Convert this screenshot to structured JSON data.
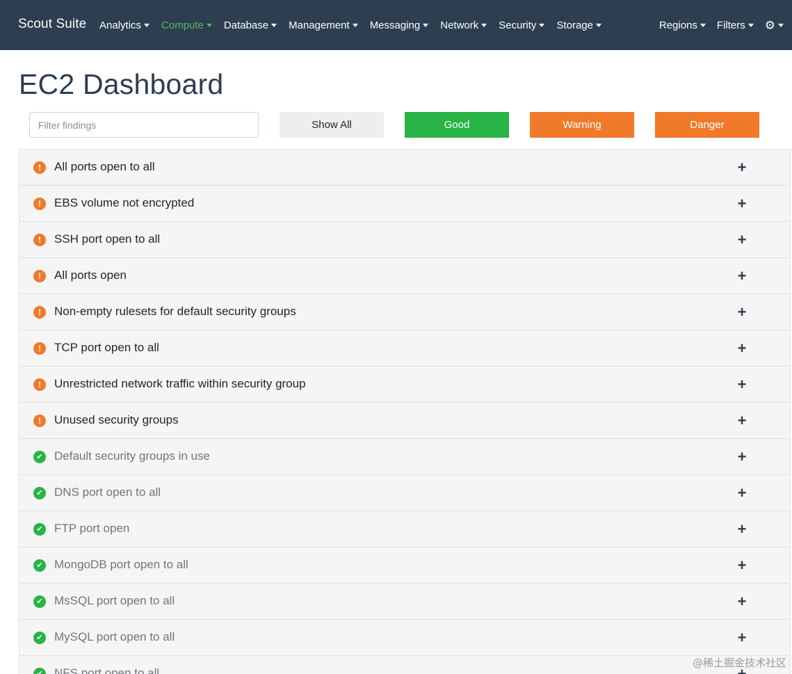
{
  "navbar": {
    "brand": "Scout Suite",
    "menus": [
      {
        "label": "Analytics",
        "active": false
      },
      {
        "label": "Compute",
        "active": true
      },
      {
        "label": "Database",
        "active": false
      },
      {
        "label": "Management",
        "active": false
      },
      {
        "label": "Messaging",
        "active": false
      },
      {
        "label": "Network",
        "active": false
      },
      {
        "label": "Security",
        "active": false
      },
      {
        "label": "Storage",
        "active": false
      }
    ],
    "right_menus": [
      {
        "label": "Regions"
      },
      {
        "label": "Filters"
      }
    ],
    "settings_icon": "gear-icon",
    "active_color": "#5cb85c",
    "background_color": "#2c3e50"
  },
  "page": {
    "title": "EC2 Dashboard"
  },
  "filters": {
    "search_placeholder": "Filter findings",
    "show_all_label": "Show All",
    "good_label": "Good",
    "warning_label": "Warning",
    "danger_label": "Danger",
    "colors": {
      "good": "#28b446",
      "warning": "#f07a2a",
      "danger": "#f07a2a"
    }
  },
  "findings": [
    {
      "title": "All ports open to all",
      "status": "warning"
    },
    {
      "title": "EBS volume not encrypted",
      "status": "warning"
    },
    {
      "title": "SSH port open to all",
      "status": "warning"
    },
    {
      "title": "All ports open",
      "status": "warning"
    },
    {
      "title": "Non-empty rulesets for default security groups",
      "status": "warning"
    },
    {
      "title": "TCP port open to all",
      "status": "warning"
    },
    {
      "title": "Unrestricted network traffic within security group",
      "status": "warning"
    },
    {
      "title": "Unused security groups",
      "status": "warning"
    },
    {
      "title": "Default security groups in use",
      "status": "good"
    },
    {
      "title": "DNS port open to all",
      "status": "good"
    },
    {
      "title": "FTP port open",
      "status": "good"
    },
    {
      "title": "MongoDB port open to all",
      "status": "good"
    },
    {
      "title": "MsSQL port open to all",
      "status": "good"
    },
    {
      "title": "MySQL port open to all",
      "status": "good"
    },
    {
      "title": "NFS port open to all",
      "status": "good"
    }
  ],
  "watermark": "@稀土掘金技术社区"
}
